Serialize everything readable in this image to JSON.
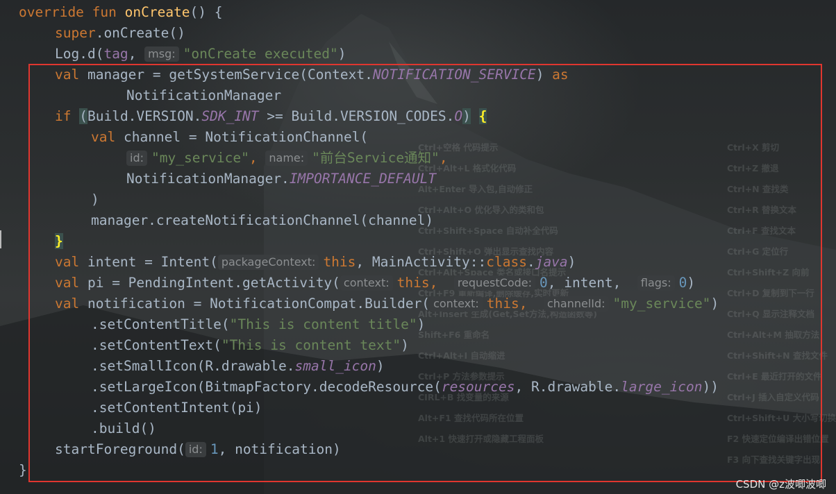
{
  "code_lines": [
    {
      "indent": 0,
      "tokens": [
        {
          "t": "override fun ",
          "c": "kw"
        },
        {
          "t": "onCreate",
          "c": "fn"
        },
        {
          "t": "() {",
          "c": ""
        }
      ]
    },
    {
      "indent": 1,
      "tokens": [
        {
          "t": "super",
          "c": "kw"
        },
        {
          "t": ".onCreate()",
          "c": ""
        }
      ]
    },
    {
      "indent": 1,
      "tokens": [
        {
          "t": "Log.d(",
          "c": ""
        },
        {
          "t": "tag",
          "c": "prop"
        },
        {
          "t": ", ",
          "c": ""
        },
        {
          "t": "msg:",
          "c": "hint"
        },
        {
          "t": "\"onCreate executed\"",
          "c": "str"
        },
        {
          "t": ")",
          "c": ""
        }
      ]
    },
    {
      "indent": 1,
      "tokens": [
        {
          "t": "val ",
          "c": "kw"
        },
        {
          "t": "manager = getSystemService(Context.",
          "c": ""
        },
        {
          "t": "NOTIFICATION_SERVICE",
          "c": "const"
        },
        {
          "t": ") ",
          "c": ""
        },
        {
          "t": "as",
          "c": "kw"
        }
      ]
    },
    {
      "indent": 3,
      "tokens": [
        {
          "t": "NotificationManager",
          "c": ""
        }
      ]
    },
    {
      "indent": 1,
      "tokens": [
        {
          "t": "if ",
          "c": "kw"
        },
        {
          "t": "(",
          "c": "paren-hl"
        },
        {
          "t": "Build.VERSION.",
          "c": ""
        },
        {
          "t": "SDK_INT",
          "c": "const"
        },
        {
          "t": " >= Build.VERSION_CODES.",
          "c": ""
        },
        {
          "t": "O",
          "c": "const"
        },
        {
          "t": ")",
          "c": "paren-hl"
        },
        {
          "t": " ",
          "c": ""
        },
        {
          "t": "{",
          "c": "brace-hl"
        }
      ]
    },
    {
      "indent": 2,
      "tokens": [
        {
          "t": "val ",
          "c": "kw"
        },
        {
          "t": "channel = NotificationChannel(",
          "c": ""
        }
      ]
    },
    {
      "indent": 3,
      "tokens": [
        {
          "t": "id:",
          "c": "hint"
        },
        {
          "t": "\"my_service\"",
          "c": "str"
        },
        {
          "t": ", ",
          "c": "kw"
        },
        {
          "t": "name:",
          "c": "hint"
        },
        {
          "t": "\"前台Service通知\"",
          "c": "str"
        },
        {
          "t": ",",
          "c": "kw"
        }
      ]
    },
    {
      "indent": 3,
      "tokens": [
        {
          "t": "NotificationManager.",
          "c": ""
        },
        {
          "t": "IMPORTANCE_DEFAULT",
          "c": "const"
        }
      ]
    },
    {
      "indent": 2,
      "tokens": [
        {
          "t": ")",
          "c": ""
        }
      ]
    },
    {
      "indent": 2,
      "tokens": [
        {
          "t": "manager.createNotificationChannel(channel)",
          "c": ""
        }
      ]
    },
    {
      "indent": 1,
      "tokens": [
        {
          "t": "}",
          "c": "brace-hl"
        }
      ]
    },
    {
      "indent": 1,
      "tokens": [
        {
          "t": "val ",
          "c": "kw"
        },
        {
          "t": "intent = Intent(",
          "c": ""
        },
        {
          "t": "packageContext:",
          "c": "hint"
        },
        {
          "t": "this",
          "c": "kw"
        },
        {
          "t": ", MainActivity::",
          "c": ""
        },
        {
          "t": "class",
          "c": "kw"
        },
        {
          "t": ".",
          "c": ""
        },
        {
          "t": "java",
          "c": "const"
        },
        {
          "t": ")",
          "c": ""
        }
      ]
    },
    {
      "indent": 1,
      "tokens": [
        {
          "t": "val ",
          "c": "kw"
        },
        {
          "t": "pi = PendingIntent.getActivity(",
          "c": ""
        },
        {
          "t": "context:",
          "c": "hint"
        },
        {
          "t": "this",
          "c": "kw"
        },
        {
          "t": ",  ",
          "c": "kw"
        },
        {
          "t": "requestCode:",
          "c": "hint"
        },
        {
          "t": "0",
          "c": "num"
        },
        {
          "t": ", intent,  ",
          "c": ""
        },
        {
          "t": "flags:",
          "c": "hint"
        },
        {
          "t": "0",
          "c": "num"
        },
        {
          "t": ")",
          "c": ""
        }
      ]
    },
    {
      "indent": 1,
      "tokens": [
        {
          "t": "val ",
          "c": "kw"
        },
        {
          "t": "notification = NotificationCompat.Builder(",
          "c": ""
        },
        {
          "t": "context:",
          "c": "hint"
        },
        {
          "t": "this",
          "c": "kw"
        },
        {
          "t": ",  ",
          "c": "kw"
        },
        {
          "t": "channelId:",
          "c": "hint"
        },
        {
          "t": "\"my_service\"",
          "c": "str"
        },
        {
          "t": ")",
          "c": ""
        }
      ]
    },
    {
      "indent": 2,
      "tokens": [
        {
          "t": ".setContentTitle(",
          "c": ""
        },
        {
          "t": "\"This is content title\"",
          "c": "str"
        },
        {
          "t": ")",
          "c": ""
        }
      ]
    },
    {
      "indent": 2,
      "tokens": [
        {
          "t": ".setContentText(",
          "c": ""
        },
        {
          "t": "\"This is content text\"",
          "c": "str"
        },
        {
          "t": ")",
          "c": ""
        }
      ]
    },
    {
      "indent": 2,
      "tokens": [
        {
          "t": ".setSmallIcon(R.drawable.",
          "c": ""
        },
        {
          "t": "small_icon",
          "c": "const"
        },
        {
          "t": ")",
          "c": ""
        }
      ]
    },
    {
      "indent": 2,
      "tokens": [
        {
          "t": ".setLargeIcon(BitmapFactory.decodeResource(",
          "c": ""
        },
        {
          "t": "resources",
          "c": "const"
        },
        {
          "t": ", R.drawable.",
          "c": ""
        },
        {
          "t": "large_icon",
          "c": "const"
        },
        {
          "t": "))",
          "c": ""
        }
      ]
    },
    {
      "indent": 2,
      "tokens": [
        {
          "t": ".setContentIntent(pi)",
          "c": ""
        }
      ]
    },
    {
      "indent": 2,
      "tokens": [
        {
          "t": ".build()",
          "c": ""
        }
      ]
    },
    {
      "indent": 1,
      "tokens": [
        {
          "t": "startForeground(",
          "c": ""
        },
        {
          "t": "id:",
          "c": "hint"
        },
        {
          "t": "1",
          "c": "num"
        },
        {
          "t": ", notification)",
          "c": ""
        }
      ]
    },
    {
      "indent": 0,
      "tokens": [
        {
          "t": "}",
          "c": ""
        }
      ]
    }
  ],
  "background_shortcuts": [
    "Ctrl+空格  代码提示",
    "Ctrl+X  剪切",
    "Ctrl+Alt+L  格式化代码",
    "Ctrl+Z  撤退",
    "Alt+Enter 导入包,自动修正",
    "Ctrl+N  查找类",
    "Ctrl+Alt+O  优化导入的类和包",
    "Ctrl+R 替换文本",
    "Ctrl+Shift+Space 自动补全代码",
    "Ctrl+F 查找文本",
    "Ctrl+Shift+O  弹出显示查找内容",
    "Ctrl+G  定位行",
    "Ctrl+Alt+Space 类名或接口名提示",
    "Ctrl+Shift+Z  向前",
    "Ctrl+F9 重新编译,删除缓存,实时更新",
    "Ctrl+D  复制到下一行",
    "Alt+Insert  生成(Get,Set方法,构造函数等)",
    "Ctrl+Q  显示注释文档",
    "Ctrl+Alt+M  抽取方法",
    "Shift+F6  重命名",
    "Ctrl+Shift+N 查找文件",
    "Ctrl+Alt+I  自动缩进",
    "Ctrl+E 最近打开的文件",
    "Ctrl+P  方法参数提示",
    "Ctrl+J  插入自定义代码",
    "CIRL+B  找变量的来源",
    "Ctrl+Shift+U 大小写切换",
    "F2 快速定位编译出错位置",
    "Alt+F1 查找代码所在位置",
    "F3  向下查找关键字出现",
    "Alt+1 快速打开或隐藏工程面板"
  ],
  "watermark": "CSDN @z波唧波唧"
}
